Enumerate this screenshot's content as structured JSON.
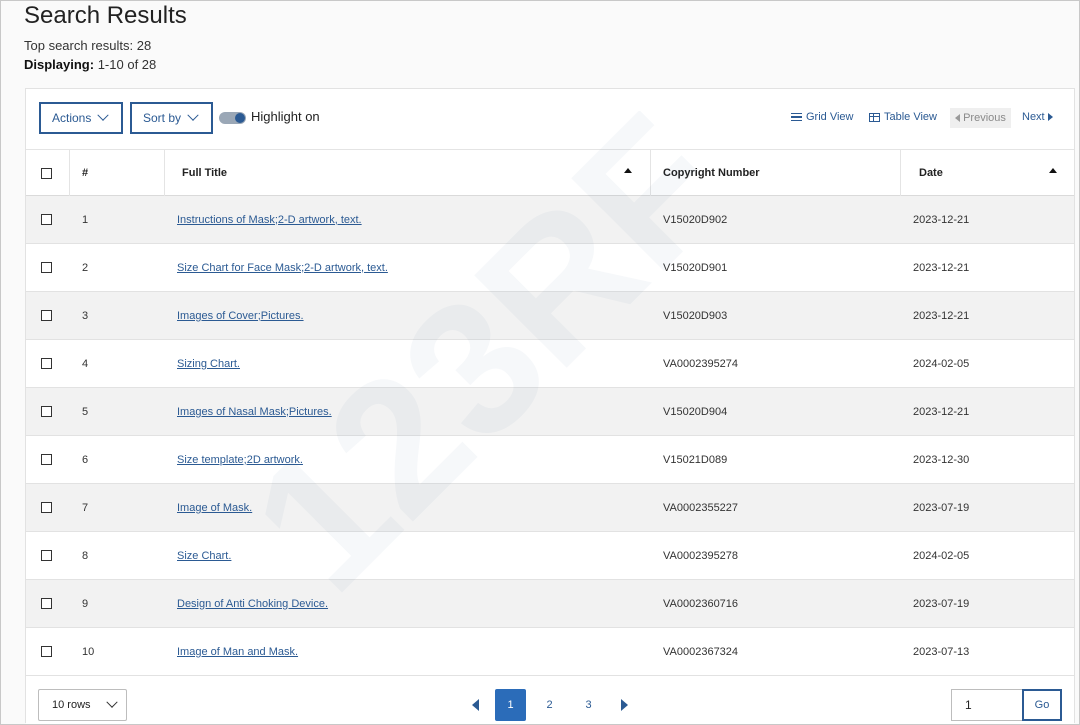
{
  "page": {
    "title": "Search Results",
    "top_results": "Top search results: 28",
    "displaying_label": "Displaying:",
    "displaying_value": "1-10 of 28"
  },
  "toolbar": {
    "actions_label": "Actions",
    "sortby_label": "Sort by",
    "highlight_label": "Highlight on",
    "highlight_on": true,
    "grid_view_label": "Grid View",
    "table_view_label": "Table View",
    "previous_label": "Previous",
    "next_label": "Next"
  },
  "table": {
    "columns": {
      "number": "#",
      "full_title": "Full Title",
      "copyright_number": "Copyright Number",
      "date": "Date"
    },
    "rows": [
      {
        "n": "1",
        "title": "Instructions of Mask;2-D artwork, text.",
        "copyright": "V15020D902",
        "date": "2023-12-21"
      },
      {
        "n": "2",
        "title": "Size Chart for Face Mask;2-D artwork, text.",
        "copyright": "V15020D901",
        "date": "2023-12-21"
      },
      {
        "n": "3",
        "title": "Images of Cover;Pictures.",
        "copyright": "V15020D903",
        "date": "2023-12-21"
      },
      {
        "n": "4",
        "title": "Sizing Chart.",
        "copyright": "VA0002395274",
        "date": "2024-02-05"
      },
      {
        "n": "5",
        "title": "Images of Nasal Mask;Pictures.",
        "copyright": "V15020D904",
        "date": "2023-12-21"
      },
      {
        "n": "6",
        "title": "Size template;2D artwork.",
        "copyright": "V15021D089",
        "date": "2023-12-30"
      },
      {
        "n": "7",
        "title": "Image of Mask.",
        "copyright": "VA0002355227",
        "date": "2023-07-19"
      },
      {
        "n": "8",
        "title": "Size Chart.",
        "copyright": "VA0002395278",
        "date": "2024-02-05"
      },
      {
        "n": "9",
        "title": "Design of Anti Choking Device.",
        "copyright": "VA0002360716",
        "date": "2023-07-19"
      },
      {
        "n": "10",
        "title": "Image of Man and Mask.",
        "copyright": "VA0002367324",
        "date": "2023-07-13"
      }
    ]
  },
  "footer": {
    "rows_per_page": "10 rows",
    "pages": [
      "1",
      "2",
      "3"
    ],
    "active_page": "1",
    "goto_value": "1",
    "go_label": "Go"
  },
  "watermark_text": "123RF",
  "colors": {
    "accent": "#2b5a93",
    "active_page": "#2b6cb9",
    "row_alt": "#f2f2f2"
  }
}
